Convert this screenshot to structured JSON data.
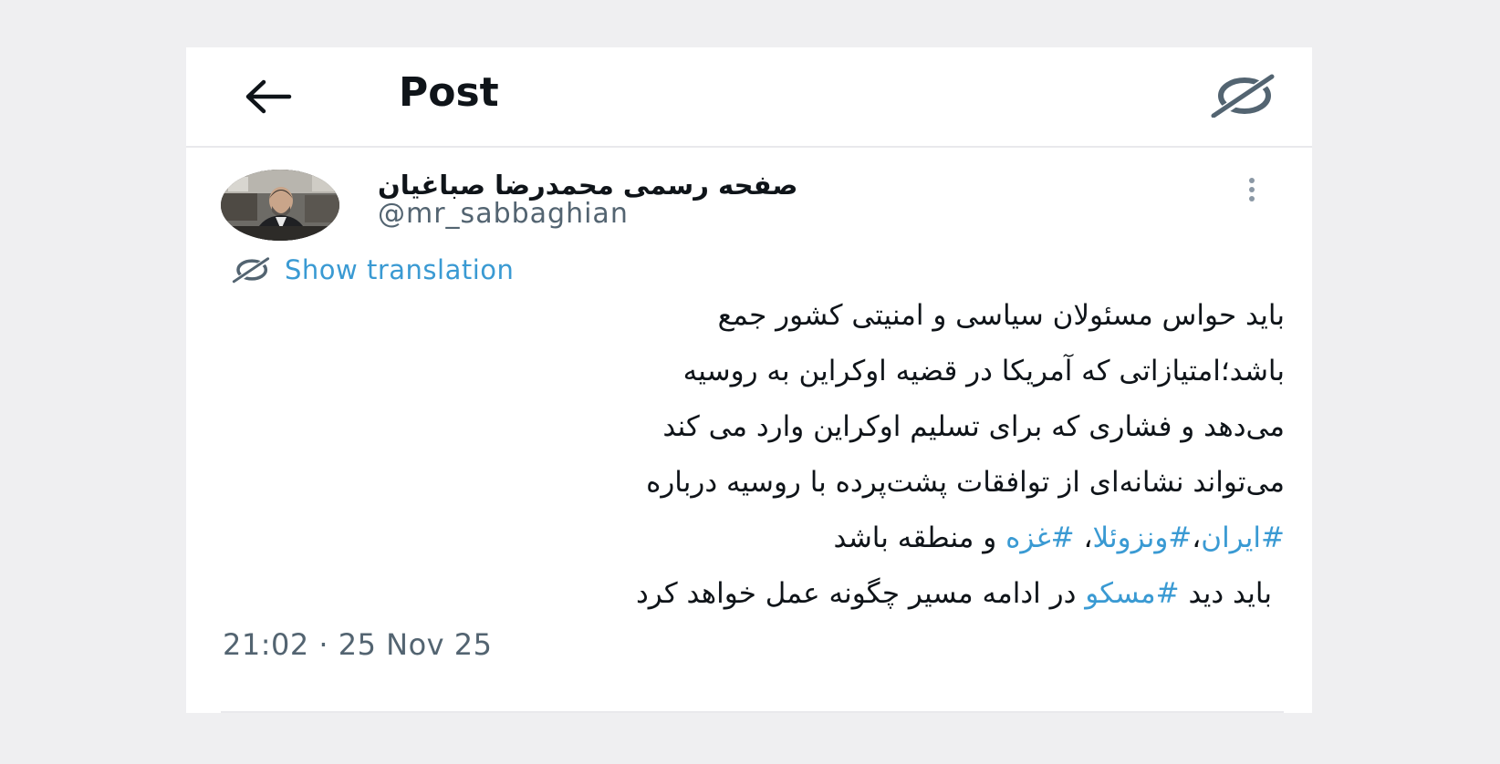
{
  "header": {
    "back_icon": "arrow-left-icon",
    "title": "Post",
    "grok_icon": "grok-icon"
  },
  "author": {
    "display_name": "صفحه رسمی محمدرضا صباغیان",
    "handle": "@mr_sabbaghian",
    "more_icon": "more-vertical-icon"
  },
  "translation": {
    "icon": "grok-icon",
    "label": "Show translation"
  },
  "post": {
    "line1": "باید حواس مسئولان سیاسی و امنیتی کشور جمع",
    "line2": "باشد؛امتیازاتی که آمریکا در قضیه اوکراین به روسیه",
    "line3": "می‌دهد و فشاری که برای تسلیم اوکراین وارد می کند",
    "line4": "می‌تواند نشانه‌ای از توافقات پشت‌پرده با روسیه درباره",
    "line5_tag1": "#ایران",
    "line5_sep1": "،",
    "line5_tag2": "#ونزوئلا",
    "line5_sep2": "، ",
    "line5_tag3": "#غزه",
    "line5_rest": " و منطقه باشد",
    "line6_pre": "باید دید ",
    "line6_tag": "#مسکو",
    "line6_rest": " در ادامه مسیر چگونه عمل خواهد کرد"
  },
  "meta": {
    "timestamp": "21:02 · 25 Nov 25"
  },
  "colors": {
    "link": "#3a9ad3",
    "text": "#0f1419",
    "secondary": "#536471",
    "page_bg": "#efeff1"
  }
}
